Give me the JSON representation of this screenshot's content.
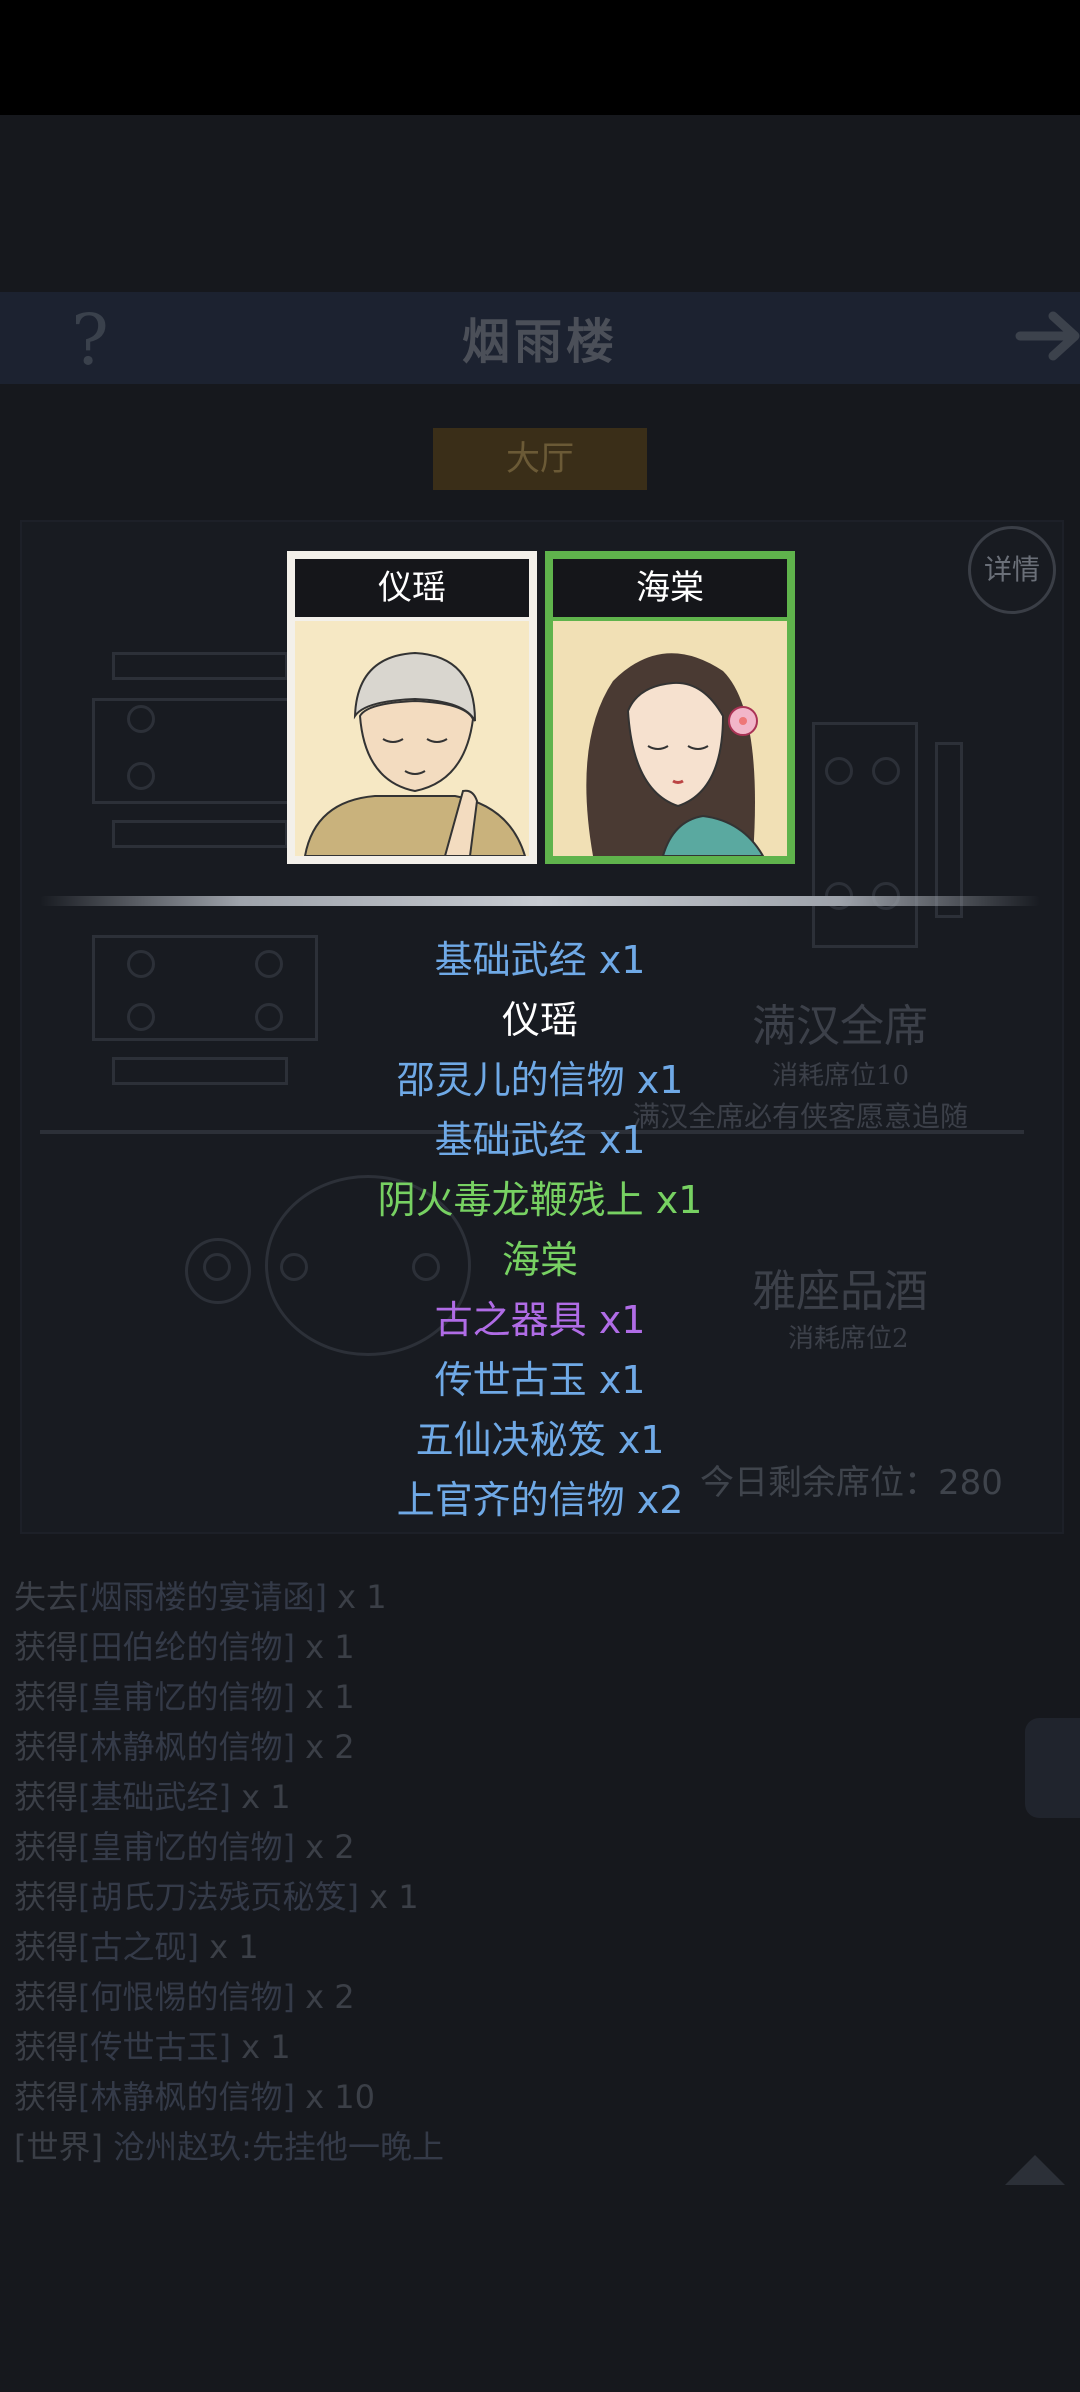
{
  "header": {
    "title": "烟雨楼",
    "help": "?"
  },
  "tab": {
    "label": "大厅"
  },
  "detail_button": "详情",
  "seats": [
    {
      "title": "满汉全席",
      "cost": "消耗席位10",
      "note": "满汉全席必有侠客愿意追随"
    },
    {
      "title": "雅座品酒",
      "cost": "消耗席位2"
    }
  ],
  "remaining": "今日剩余席位：280",
  "cards": [
    {
      "name": "仪瑶",
      "selected": false
    },
    {
      "name": "海棠",
      "selected": true
    }
  ],
  "rewards": [
    {
      "text": "基础武经 x1",
      "color": "#6fa9e6"
    },
    {
      "text": "仪瑶",
      "color": "#ffffff"
    },
    {
      "text": "邵灵儿的信物 x1",
      "color": "#6fa9e6"
    },
    {
      "text": "基础武经 x1",
      "color": "#6fa9e6"
    },
    {
      "text": "阴火毒龙鞭残上 x1",
      "color": "#77d162"
    },
    {
      "text": "海棠",
      "color": "#77d162"
    },
    {
      "text": "古之器具 x1",
      "color": "#b06ce6"
    },
    {
      "text": "传世古玉 x1",
      "color": "#6fa9e6"
    },
    {
      "text": "五仙决秘笈 x1",
      "color": "#6fa9e6"
    },
    {
      "text": "上官齐的信物 x2",
      "color": "#6fa9e6"
    }
  ],
  "log": [
    {
      "verb": "失去",
      "item": "[烟雨楼的宴请函]",
      "qty": " x 1"
    },
    {
      "verb": "获得",
      "item": "[田伯纶的信物]",
      "qty": " x 1"
    },
    {
      "verb": "获得",
      "item": "[皇甫忆的信物]",
      "qty": " x 1"
    },
    {
      "verb": "获得",
      "item": "[林静枫的信物]",
      "qty": " x 2"
    },
    {
      "verb": "获得",
      "item": "[基础武经]",
      "qty": " x 1"
    },
    {
      "verb": "获得",
      "item": "[皇甫忆的信物]",
      "qty": " x 2"
    },
    {
      "verb": "获得",
      "item": "[胡氏刀法残页秘笈]",
      "qty": " x 1"
    },
    {
      "verb": "获得",
      "item": "[古之砚]",
      "qty": " x 1"
    },
    {
      "verb": "获得",
      "item": "[何恨惕的信物]",
      "qty": " x 2"
    },
    {
      "verb": "获得",
      "item": "[传世古玉]",
      "qty": " x 1"
    },
    {
      "verb": "获得",
      "item": "[林静枫的信物]",
      "qty": " x 10"
    },
    {
      "verb": "[世界]",
      "item": " 沧州赵玖:先挂他一晚上",
      "qty": ""
    }
  ]
}
